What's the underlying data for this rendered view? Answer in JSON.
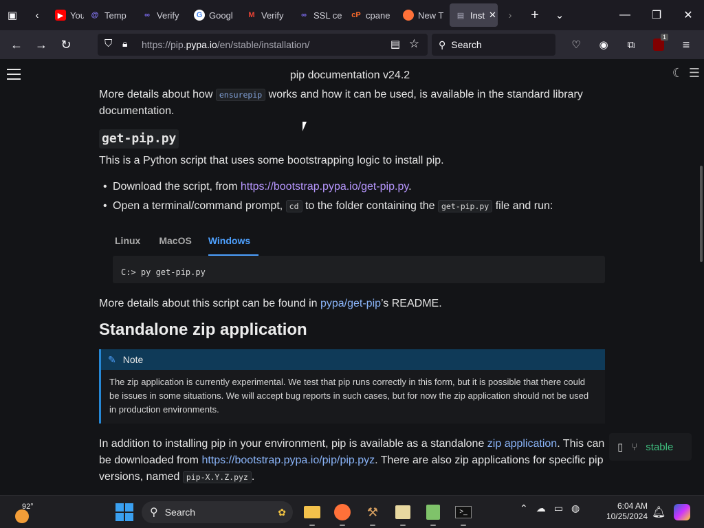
{
  "browser": {
    "tabs": [
      {
        "label": "YouT",
        "icon": "youtube-icon"
      },
      {
        "label": "Temp",
        "icon": "at-icon"
      },
      {
        "label": "Verify",
        "icon": "infinity-icon"
      },
      {
        "label": "Googl",
        "icon": "google-icon"
      },
      {
        "label": "Verify",
        "icon": "gmail-icon"
      },
      {
        "label": "SSL ce",
        "icon": "infinity-icon"
      },
      {
        "label": "cpane",
        "icon": "cpanel-icon"
      },
      {
        "label": "New T",
        "icon": "firefox-icon"
      },
      {
        "label": "Inst",
        "icon": "docs-icon",
        "active": true
      }
    ],
    "url": {
      "prefix": "https://pip.",
      "domain": "pypa.io",
      "path": "/en/stable/installation/"
    },
    "search_placeholder": "Search",
    "extension_badge": "1"
  },
  "page": {
    "header_title": "pip documentation v24.2",
    "intro": {
      "part1": "More details about how ",
      "code": "ensurepip",
      "part2": " works and how it can be used, is available in the standard library documentation."
    },
    "getpip": {
      "heading": "get-pip.py",
      "desc": "This is a Python script that uses some bootstrapping logic to install pip.",
      "bullet1_text": "Download the script, from ",
      "bullet1_link": "https://bootstrap.pypa.io/get-pip.py",
      "bullet1_end": ".",
      "bullet2_a": "Open a terminal/command prompt, ",
      "bullet2_code1": "cd",
      "bullet2_b": " to the folder containing the ",
      "bullet2_code2": "get-pip.py",
      "bullet2_c": " file and run:",
      "os_tabs": [
        "Linux",
        "MacOS",
        "Windows"
      ],
      "selected_tab": "Windows",
      "command": "C:> py get-pip.py",
      "more_a": "More details about this script can be found in ",
      "more_link": "pypa/get-pip",
      "more_b": "’s README."
    },
    "zipapp": {
      "heading": "Standalone zip application",
      "note_title": "Note",
      "note_body": "The zip application is currently experimental. We test that pip runs correctly in this form, but it is possible that there could be issues in some situations. We will accept bug reports in such cases, but for now the zip application should not be used in production environments.",
      "p_a": "In addition to installing pip in your environment, pip is available as a standalone ",
      "p_link1": "zip application",
      "p_b": ". This can be downloaded from ",
      "p_link2": "https://bootstrap.pypa.io/pip/pip.pyz",
      "p_c": ". There are also zip applications for specific pip versions, named ",
      "p_code": "pip-X.Y.Z.pyz",
      "p_d": "."
    },
    "version_badge": "stable"
  },
  "taskbar": {
    "temperature": "92°",
    "search_label": "Search",
    "time": "6:04 AM",
    "date": "10/25/2024"
  }
}
